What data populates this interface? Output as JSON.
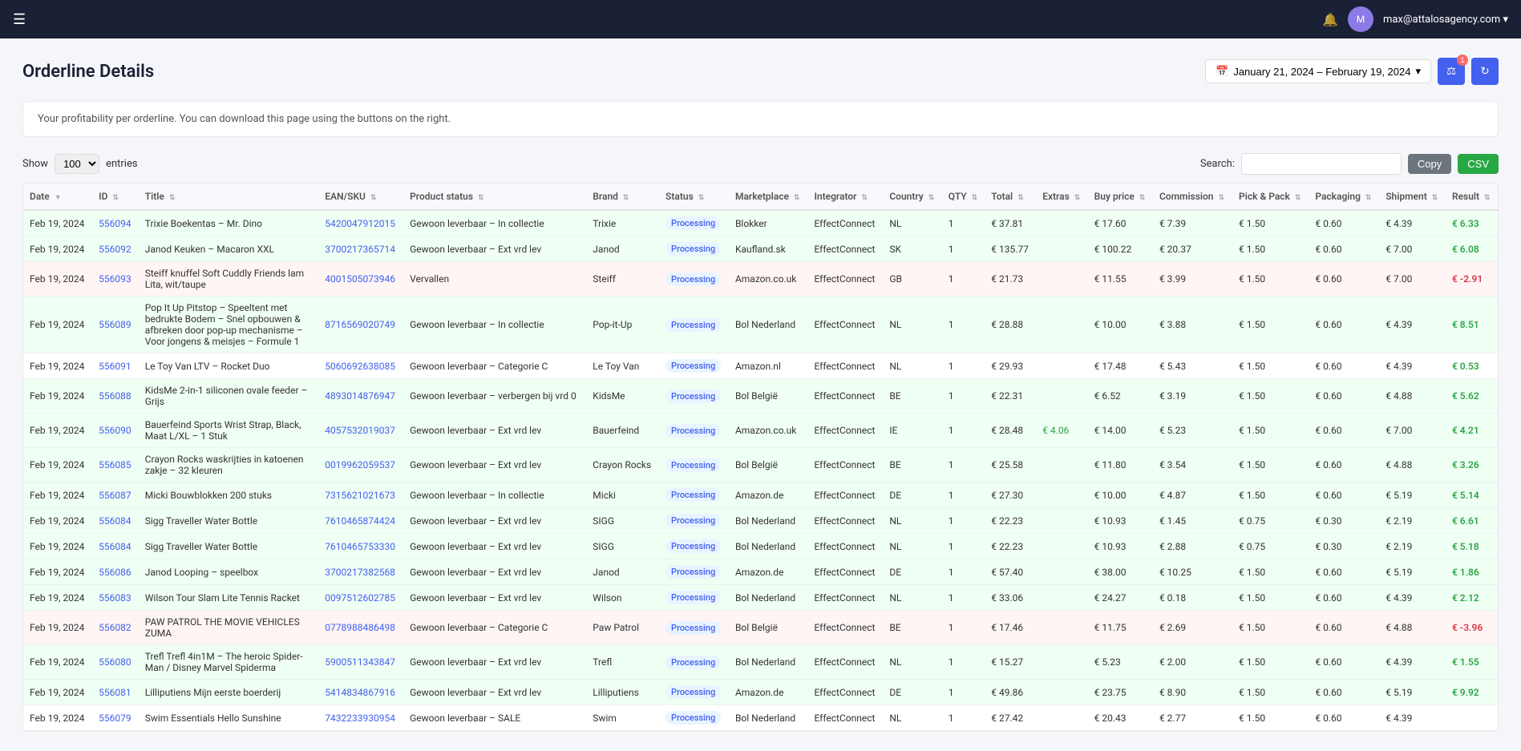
{
  "navbar": {
    "hamburger": "☰",
    "bell": "🔕",
    "user_name": "max@attalosagency.com ▾",
    "avatar_initials": "M"
  },
  "page": {
    "title": "Orderline Details",
    "subtitle": "Your profitability per orderline. You can download this page using the buttons on the right.",
    "date_range": "January 21, 2024 – February 19, 2024",
    "show_label": "Show",
    "entries_label": "entries",
    "show_value": "100",
    "search_label": "Search:",
    "copy_label": "Copy",
    "csv_label": "CSV"
  },
  "table": {
    "columns": [
      "Date",
      "ID",
      "Title",
      "EAN/SKU",
      "Product status",
      "Brand",
      "Status",
      "Marketplace",
      "Integrator",
      "Country",
      "QTY",
      "Total",
      "Extras",
      "Buy price",
      "Commission",
      "Pick & Pack",
      "Packaging",
      "Shipment",
      "Result"
    ],
    "rows": [
      {
        "date": "Feb 19, 2024",
        "id": "556094",
        "title": "Trixie Boekentas – Mr. Dino",
        "ean": "5420047912015",
        "product_status": "Gewoon leverbaar – In collectie",
        "brand": "Trixie",
        "status": "Processing",
        "marketplace": "Blokker",
        "integrator": "EffectConnect",
        "country": "NL",
        "qty": "1",
        "total": "€ 37.81",
        "extras": "",
        "buy_price": "€ 17.60",
        "commission": "€ 7.39",
        "pick_pack": "€ 1.50",
        "packaging": "€ 0.60",
        "shipment": "€ 4.39",
        "result": "€ 6.33",
        "row_class": "row-green"
      },
      {
        "date": "Feb 19, 2024",
        "id": "556092",
        "title": "Janod Keuken – Macaron XXL",
        "ean": "3700217365714",
        "product_status": "Gewoon leverbaar – Ext vrd lev",
        "brand": "Janod",
        "status": "Processing",
        "marketplace": "Kaufland.sk",
        "integrator": "EffectConnect",
        "country": "SK",
        "qty": "1",
        "total": "€ 135.77",
        "extras": "",
        "buy_price": "€ 100.22",
        "commission": "€ 20.37",
        "pick_pack": "€ 1.50",
        "packaging": "€ 0.60",
        "shipment": "€ 7.00",
        "result": "€ 6.08",
        "row_class": "row-green"
      },
      {
        "date": "Feb 19, 2024",
        "id": "556093",
        "title": "Steiff knuffel Soft Cuddly Friends lam Lita, wit/taupe",
        "ean": "4001505073946",
        "product_status": "Vervallen",
        "brand": "Steiff",
        "status": "Processing",
        "marketplace": "Amazon.co.uk",
        "integrator": "EffectConnect",
        "country": "GB",
        "qty": "1",
        "total": "€ 21.73",
        "extras": "",
        "buy_price": "€ 11.55",
        "commission": "€ 3.99",
        "pick_pack": "€ 1.50",
        "packaging": "€ 0.60",
        "shipment": "€ 7.00",
        "result": "€ -2.91",
        "row_class": "row-red"
      },
      {
        "date": "Feb 19, 2024",
        "id": "556089",
        "title": "Pop It Up Pitstop – Speeltent met bedrukte Bodem – Snel opbouwen & afbreken door pop-up mechanisme – Voor jongens & meisjes – Formule 1",
        "ean": "8716569020749",
        "product_status": "Gewoon leverbaar – In collectie",
        "brand": "Pop-it-Up",
        "status": "Processing",
        "marketplace": "Bol Nederland",
        "integrator": "EffectConnect",
        "country": "NL",
        "qty": "1",
        "total": "€ 28.88",
        "extras": "",
        "buy_price": "€ 10.00",
        "commission": "€ 3.88",
        "pick_pack": "€ 1.50",
        "packaging": "€ 0.60",
        "shipment": "€ 4.39",
        "result": "€ 8.51",
        "row_class": "row-green"
      },
      {
        "date": "Feb 19, 2024",
        "id": "556091",
        "title": "Le Toy Van LTV – Rocket Duo",
        "ean": "5060692638085",
        "product_status": "Gewoon leverbaar – Categorie C",
        "brand": "Le Toy Van",
        "status": "Processing",
        "marketplace": "Amazon.nl",
        "integrator": "EffectConnect",
        "country": "NL",
        "qty": "1",
        "total": "€ 29.93",
        "extras": "",
        "buy_price": "€ 17.48",
        "commission": "€ 5.43",
        "pick_pack": "€ 1.50",
        "packaging": "€ 0.60",
        "shipment": "€ 4.39",
        "result": "€ 0.53",
        "row_class": "row-white"
      },
      {
        "date": "Feb 19, 2024",
        "id": "556088",
        "title": "KidsMe 2-in-1 siliconen ovale feeder – Grijs",
        "ean": "4893014876947",
        "product_status": "Gewoon leverbaar – verbergen bij vrd 0",
        "brand": "KidsMe",
        "status": "Processing",
        "marketplace": "Bol België",
        "integrator": "EffectConnect",
        "country": "BE",
        "qty": "1",
        "total": "€ 22.31",
        "extras": "",
        "buy_price": "€ 6.52",
        "commission": "€ 3.19",
        "pick_pack": "€ 1.50",
        "packaging": "€ 0.60",
        "shipment": "€ 4.88",
        "result": "€ 5.62",
        "row_class": "row-green"
      },
      {
        "date": "Feb 19, 2024",
        "id": "556090",
        "title": "Bauerfeind Sports Wrist Strap, Black, Maat L/XL – 1 Stuk",
        "ean": "4057532019037",
        "product_status": "Gewoon leverbaar – Ext vrd lev",
        "brand": "Bauerfeind",
        "status": "Processing",
        "marketplace": "Amazon.co.uk",
        "integrator": "EffectConnect",
        "country": "IE",
        "qty": "1",
        "total": "€ 28.48",
        "extras": "€ 4.06",
        "buy_price": "€ 14.00",
        "commission": "€ 5.23",
        "pick_pack": "€ 1.50",
        "packaging": "€ 0.60",
        "shipment": "€ 7.00",
        "result": "€ 4.21",
        "row_class": "row-green"
      },
      {
        "date": "Feb 19, 2024",
        "id": "556085",
        "title": "Crayon Rocks waskrijties in katoenen zakje – 32 kleuren",
        "ean": "0019962059537",
        "product_status": "Gewoon leverbaar – Ext vrd lev",
        "brand": "Crayon Rocks",
        "status": "Processing",
        "marketplace": "Bol België",
        "integrator": "EffectConnect",
        "country": "BE",
        "qty": "1",
        "total": "€ 25.58",
        "extras": "",
        "buy_price": "€ 11.80",
        "commission": "€ 3.54",
        "pick_pack": "€ 1.50",
        "packaging": "€ 0.60",
        "shipment": "€ 4.88",
        "result": "€ 3.26",
        "row_class": "row-green"
      },
      {
        "date": "Feb 19, 2024",
        "id": "556087",
        "title": "Micki Bouwblokken 200 stuks",
        "ean": "7315621021673",
        "product_status": "Gewoon leverbaar – In collectie",
        "brand": "Micki",
        "status": "Processing",
        "marketplace": "Amazon.de",
        "integrator": "EffectConnect",
        "country": "DE",
        "qty": "1",
        "total": "€ 27.30",
        "extras": "",
        "buy_price": "€ 10.00",
        "commission": "€ 4.87",
        "pick_pack": "€ 1.50",
        "packaging": "€ 0.60",
        "shipment": "€ 5.19",
        "result": "€ 5.14",
        "row_class": "row-green"
      },
      {
        "date": "Feb 19, 2024",
        "id": "556084",
        "title": "Sigg Traveller Water Bottle",
        "ean": "7610465874424",
        "product_status": "Gewoon leverbaar – Ext vrd lev",
        "brand": "SIGG",
        "status": "Processing",
        "marketplace": "Bol Nederland",
        "integrator": "EffectConnect",
        "country": "NL",
        "qty": "1",
        "total": "€ 22.23",
        "extras": "",
        "buy_price": "€ 10.93",
        "commission": "€ 1.45",
        "pick_pack": "€ 0.75",
        "packaging": "€ 0.30",
        "shipment": "€ 2.19",
        "result": "€ 6.61",
        "row_class": "row-green"
      },
      {
        "date": "Feb 19, 2024",
        "id": "556084",
        "title": "Sigg Traveller Water Bottle",
        "ean": "7610465753330",
        "product_status": "Gewoon leverbaar – Ext vrd lev",
        "brand": "SIGG",
        "status": "Processing",
        "marketplace": "Bol Nederland",
        "integrator": "EffectConnect",
        "country": "NL",
        "qty": "1",
        "total": "€ 22.23",
        "extras": "",
        "buy_price": "€ 10.93",
        "commission": "€ 2.88",
        "pick_pack": "€ 0.75",
        "packaging": "€ 0.30",
        "shipment": "€ 2.19",
        "result": "€ 5.18",
        "row_class": "row-green"
      },
      {
        "date": "Feb 19, 2024",
        "id": "556086",
        "title": "Janod Looping – speelbox",
        "ean": "3700217382568",
        "product_status": "Gewoon leverbaar – Ext vrd lev",
        "brand": "Janod",
        "status": "Processing",
        "marketplace": "Amazon.de",
        "integrator": "EffectConnect",
        "country": "DE",
        "qty": "1",
        "total": "€ 57.40",
        "extras": "",
        "buy_price": "€ 38.00",
        "commission": "€ 10.25",
        "pick_pack": "€ 1.50",
        "packaging": "€ 0.60",
        "shipment": "€ 5.19",
        "result": "€ 1.86",
        "row_class": "row-green"
      },
      {
        "date": "Feb 19, 2024",
        "id": "556083",
        "title": "Wilson Tour Slam Lite Tennis Racket",
        "ean": "0097512602785",
        "product_status": "Gewoon leverbaar – Ext vrd lev",
        "brand": "Wilson",
        "status": "Processing",
        "marketplace": "Bol Nederland",
        "integrator": "EffectConnect",
        "country": "NL",
        "qty": "1",
        "total": "€ 33.06",
        "extras": "",
        "buy_price": "€ 24.27",
        "commission": "€ 0.18",
        "pick_pack": "€ 1.50",
        "packaging": "€ 0.60",
        "shipment": "€ 4.39",
        "result": "€ 2.12",
        "row_class": "row-green"
      },
      {
        "date": "Feb 19, 2024",
        "id": "556082",
        "title": "PAW PATROL THE MOVIE VEHICLES ZUMA",
        "ean": "0778988486498",
        "product_status": "Gewoon leverbaar – Categorie C",
        "brand": "Paw Patrol",
        "status": "Processing",
        "marketplace": "Bol België",
        "integrator": "EffectConnect",
        "country": "BE",
        "qty": "1",
        "total": "€ 17.46",
        "extras": "",
        "buy_price": "€ 11.75",
        "commission": "€ 2.69",
        "pick_pack": "€ 1.50",
        "packaging": "€ 0.60",
        "shipment": "€ 4.88",
        "result": "€ -3.96",
        "row_class": "row-red"
      },
      {
        "date": "Feb 19, 2024",
        "id": "556080",
        "title": "Trefl Trefl 4in1M – The heroic Spider-Man / Disney Marvel Spiderma",
        "ean": "5900511343847",
        "product_status": "Gewoon leverbaar – Ext vrd lev",
        "brand": "Trefl",
        "status": "Processing",
        "marketplace": "Bol Nederland",
        "integrator": "EffectConnect",
        "country": "NL",
        "qty": "1",
        "total": "€ 15.27",
        "extras": "",
        "buy_price": "€ 5.23",
        "commission": "€ 2.00",
        "pick_pack": "€ 1.50",
        "packaging": "€ 0.60",
        "shipment": "€ 4.39",
        "result": "€ 1.55",
        "row_class": "row-green"
      },
      {
        "date": "Feb 19, 2024",
        "id": "556081",
        "title": "Lilliputiens Mijn eerste boerderij",
        "ean": "5414834867916",
        "product_status": "Gewoon leverbaar – Ext vrd lev",
        "brand": "Lilliputiens",
        "status": "Processing",
        "marketplace": "Amazon.de",
        "integrator": "EffectConnect",
        "country": "DE",
        "qty": "1",
        "total": "€ 49.86",
        "extras": "",
        "buy_price": "€ 23.75",
        "commission": "€ 8.90",
        "pick_pack": "€ 1.50",
        "packaging": "€ 0.60",
        "shipment": "€ 5.19",
        "result": "€ 9.92",
        "row_class": "row-green"
      },
      {
        "date": "Feb 19, 2024",
        "id": "556079",
        "title": "Swim Essentials Hello Sunshine",
        "ean": "7432233930954",
        "product_status": "Gewoon leverbaar – SALE",
        "brand": "Swim",
        "status": "Processing",
        "marketplace": "Bol Nederland",
        "integrator": "EffectConnect",
        "country": "NL",
        "qty": "1",
        "total": "€ 27.42",
        "extras": "",
        "buy_price": "€ 20.43",
        "commission": "€ 2.77",
        "pick_pack": "€ 1.50",
        "packaging": "€ 0.60",
        "shipment": "€ 4.39",
        "result": "",
        "row_class": "row-white"
      }
    ]
  }
}
